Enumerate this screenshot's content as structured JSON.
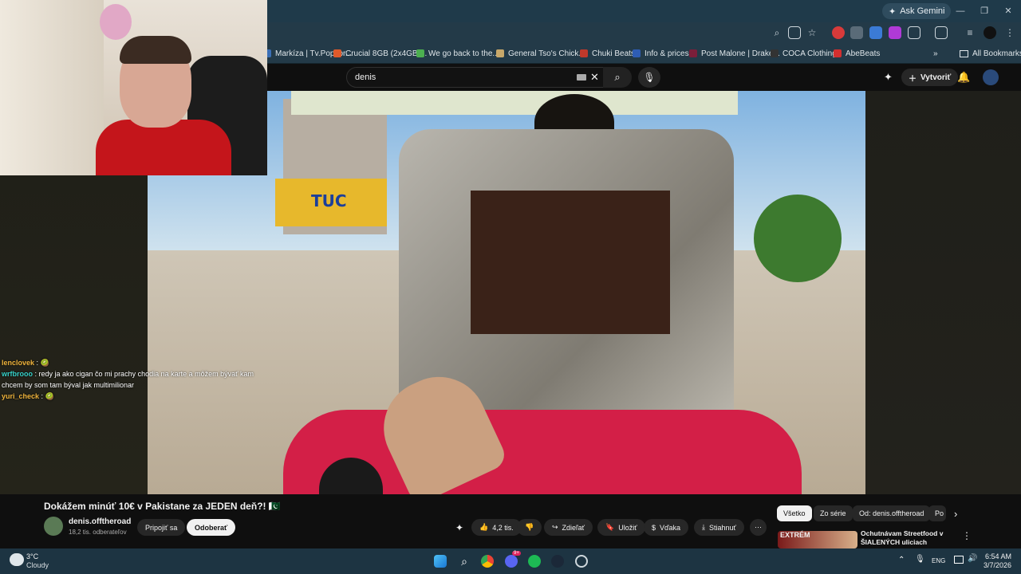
{
  "browser": {
    "ask_gemini": "Ask Gemini",
    "bookmarks": [
      {
        "label": "Markíza | Tv.Popcor...",
        "color": "#3b6fb6"
      },
      {
        "label": "Crucial 8GB (2x4GB)...",
        "color": "#e05a2b"
      },
      {
        "label": "We go back to the...",
        "color": "#4caf50"
      },
      {
        "label": "General Tso's Chick...",
        "color": "#c8a86a"
      },
      {
        "label": "Chuki Beats",
        "color": "#c0392b"
      },
      {
        "label": "Info & prices",
        "color": "#2e5db5"
      },
      {
        "label": "Post Malone | Drake...",
        "color": "#7b1e3a"
      },
      {
        "label": "COCA Clothing",
        "color": "#333333"
      },
      {
        "label": "AbeBeats",
        "color": "#d32f2f"
      }
    ],
    "bookmarks_more": "»",
    "all_bookmarks": "All Bookmarks"
  },
  "youtube": {
    "search_value": "denis",
    "create_label": "Vytvoriť",
    "video_title": "Dokážem minúť 10€ v Pakistane za JEDEN deň?! 🇵🇰",
    "channel_name": "denis.offtheroad",
    "subscribers": "18,2 tis. odberateľov",
    "join_label": "Pripojiť sa",
    "subscribe_label": "Odoberať",
    "likes": "4,2 tis.",
    "share_label": "Zdieľať",
    "save_label": "Uložiť",
    "thanks_label": "Vďaka",
    "download_label": "Stiahnuť",
    "more_label": "⋯",
    "chips": [
      "Všetko",
      "Zo série",
      "Od: denis.offtheroad",
      "Po"
    ],
    "rec_thumb_text": "EXTRÉM",
    "rec_title": "Ochutnávam Streetfood v ŠIALENÝCH uliciach Pakistan..."
  },
  "video_text": {
    "wall_sign": "TUC"
  },
  "chat": [
    {
      "user": "lenclovek",
      "color": "#f0b43c",
      "message": "🥝"
    },
    {
      "user": "wrfbrooo",
      "color": "#36d0c8",
      "message": "redy ja ako cigan čo mi prachy chodia na karte a môžem bývať kam chcem by som tam býval jak multimilionar"
    },
    {
      "user": "yuri_check",
      "color": "#f0b43c",
      "message": "🥝"
    }
  ],
  "taskbar": {
    "temperature": "3°C",
    "condition": "Cloudy",
    "language": "ENG",
    "time": "6:54 AM",
    "date": "3/7/2026",
    "discord_badge": "9+"
  }
}
